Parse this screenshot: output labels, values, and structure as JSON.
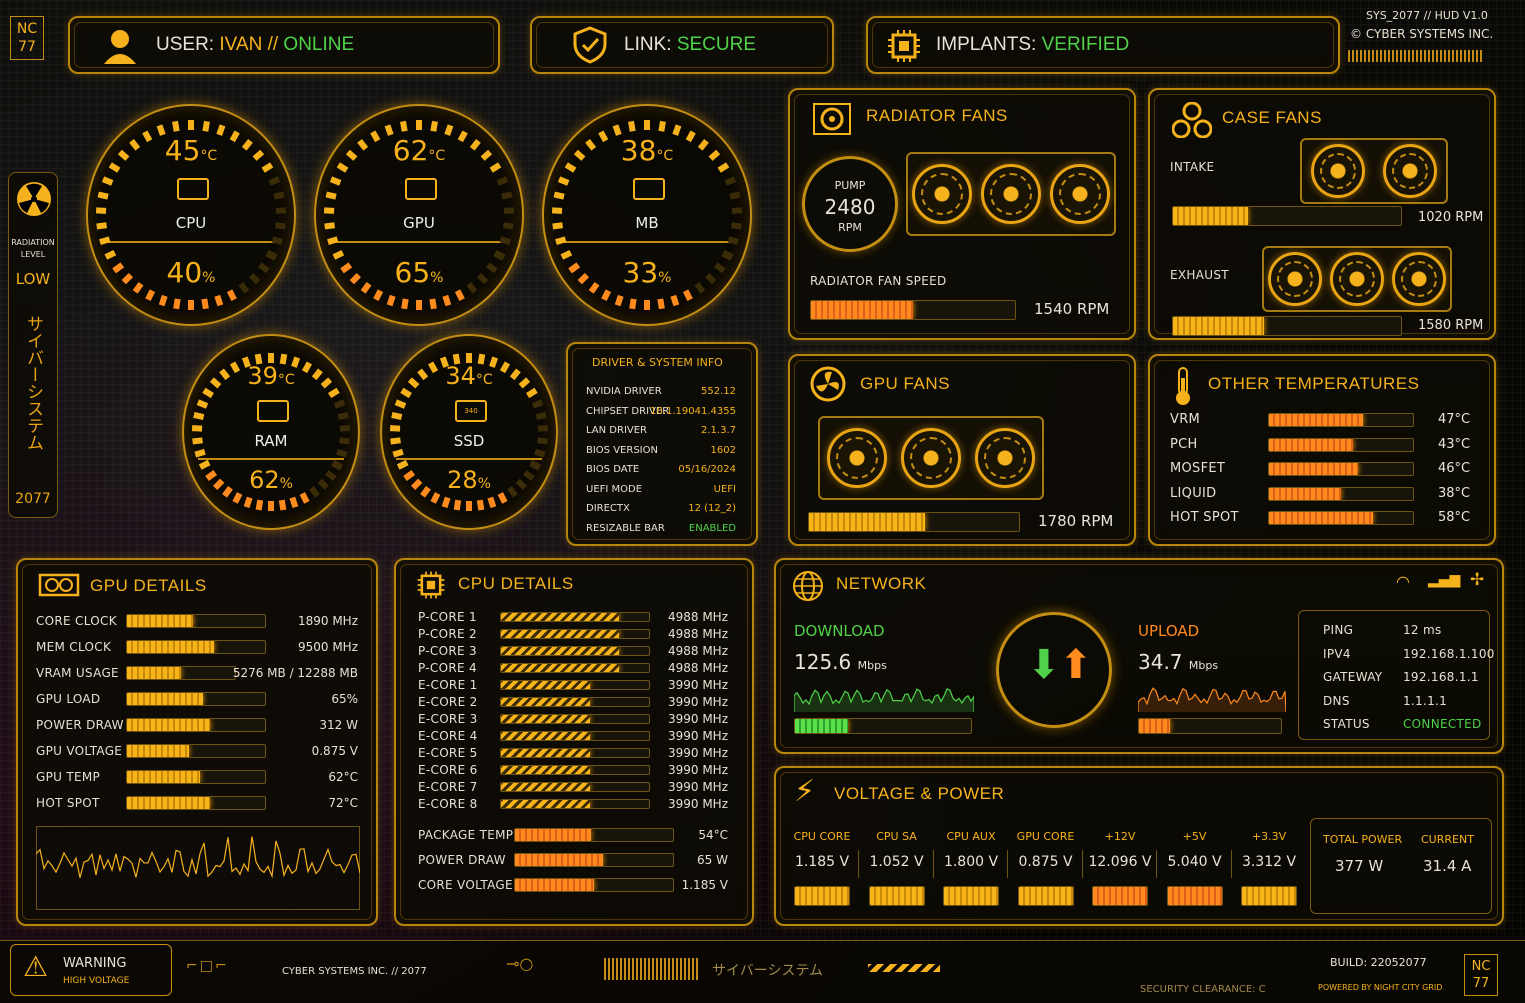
{
  "top": {
    "logo": "NC\n77",
    "user_label": "USER:",
    "user_name": "IVAN",
    "user_sep": "//",
    "user_status": "ONLINE",
    "link_label": "LINK:",
    "link_status": "SECURE",
    "implants_label": "IMPLANTS:",
    "implants_status": "VERIFIED",
    "sys": "SYS_2077 // HUD V1.0",
    "company": "© CYBER SYSTEMS INC."
  },
  "side": {
    "rad_label": "RADIATION LEVEL",
    "rad_value": "LOW",
    "jp": "サイバーシステム",
    "year": "2077"
  },
  "gauges": [
    {
      "name": "CPU",
      "temp": "45",
      "unit": "°C",
      "load": "40",
      "pct": "%"
    },
    {
      "name": "GPU",
      "temp": "62",
      "unit": "°C",
      "load": "65",
      "pct": "%"
    },
    {
      "name": "MB",
      "temp": "38",
      "unit": "°C",
      "load": "33",
      "pct": "%"
    },
    {
      "name": "RAM",
      "temp": "39",
      "unit": "°C",
      "load": "62",
      "pct": "%"
    },
    {
      "name": "SSD",
      "temp": "34",
      "unit": "°C",
      "load": "28",
      "pct": "%",
      "chip": "340"
    }
  ],
  "driver": {
    "title": "DRIVER & SYSTEM INFO",
    "rows": [
      {
        "k": "NVIDIA DRIVER",
        "v": "552.12"
      },
      {
        "k": "CHIPSET DRIVER",
        "v": "10.1.19041.4355"
      },
      {
        "k": "LAN DRIVER",
        "v": "2.1.3.7"
      },
      {
        "k": "BIOS VERSION",
        "v": "1602"
      },
      {
        "k": "BIOS DATE",
        "v": "05/16/2024"
      },
      {
        "k": "UEFI MODE",
        "v": "UEFI"
      },
      {
        "k": "DIRECTX",
        "v": "12 (12_2)"
      },
      {
        "k": "RESIZABLE BAR",
        "v": "ENABLED"
      }
    ]
  },
  "radiator": {
    "title": "RADIATOR FANS",
    "pump_label": "PUMP",
    "pump_value": "2480",
    "pump_unit": "RPM",
    "speed_label": "RADIATOR FAN SPEED",
    "speed": "1540 RPM",
    "fill": 0.5
  },
  "case": {
    "title": "CASE FANS",
    "intake_label": "INTAKE",
    "intake": "1020 RPM",
    "intake_fill": 0.33,
    "exhaust_label": "EXHAUST",
    "exhaust": "1580 RPM",
    "exhaust_fill": 0.4
  },
  "gpufans": {
    "title": "GPU FANS",
    "speed": "1780 RPM",
    "fill": 0.55
  },
  "othertemps": {
    "title": "OTHER TEMPERATURES",
    "rows": [
      {
        "k": "VRM",
        "v": "47°C",
        "f": 0.65
      },
      {
        "k": "PCH",
        "v": "43°C",
        "f": 0.58
      },
      {
        "k": "MOSFET",
        "v": "46°C",
        "f": 0.62
      },
      {
        "k": "LIQUID",
        "v": "38°C",
        "f": 0.5
      },
      {
        "k": "HOT SPOT",
        "v": "58°C",
        "f": 0.72
      }
    ]
  },
  "gpudetails": {
    "title": "GPU DETAILS",
    "rows": [
      {
        "k": "CORE CLOCK",
        "v": "1890 MHz",
        "f": 0.48
      },
      {
        "k": "MEM CLOCK",
        "v": "9500 MHz",
        "f": 0.63
      },
      {
        "k": "VRAM USAGE",
        "v": "5276 MB / 12288 MB",
        "f": 0.5
      },
      {
        "k": "GPU LOAD",
        "v": "65%",
        "f": 0.55
      },
      {
        "k": "POWER DRAW",
        "v": "312 W",
        "f": 0.6
      },
      {
        "k": "GPU VOLTAGE",
        "v": "0.875 V",
        "f": 0.45
      },
      {
        "k": "GPU TEMP",
        "v": "62°C",
        "f": 0.53
      },
      {
        "k": "HOT SPOT",
        "v": "72°C",
        "f": 0.6
      }
    ]
  },
  "cpudetails": {
    "title": "CPU DETAILS",
    "cores": [
      {
        "k": "P-CORE 1",
        "v": "4988 MHz",
        "f": 0.8
      },
      {
        "k": "P-CORE 2",
        "v": "4988 MHz",
        "f": 0.8
      },
      {
        "k": "P-CORE 3",
        "v": "4988 MHz",
        "f": 0.8
      },
      {
        "k": "P-CORE 4",
        "v": "4988 MHz",
        "f": 0.8
      },
      {
        "k": "E-CORE 1",
        "v": "3990 MHz",
        "f": 0.6
      },
      {
        "k": "E-CORE 2",
        "v": "3990 MHz",
        "f": 0.6
      },
      {
        "k": "E-CORE 3",
        "v": "3990 MHz",
        "f": 0.6
      },
      {
        "k": "E-CORE 4",
        "v": "3990 MHz",
        "f": 0.6
      },
      {
        "k": "E-CORE 5",
        "v": "3990 MHz",
        "f": 0.6
      },
      {
        "k": "E-CORE 6",
        "v": "3990 MHz",
        "f": 0.6
      },
      {
        "k": "E-CORE 7",
        "v": "3990 MHz",
        "f": 0.6
      },
      {
        "k": "E-CORE 8",
        "v": "3990 MHz",
        "f": 0.6
      }
    ],
    "extra": [
      {
        "k": "PACKAGE TEMP",
        "v": "54°C",
        "f": 0.48
      },
      {
        "k": "POWER DRAW",
        "v": "65 W",
        "f": 0.56
      },
      {
        "k": "CORE VOLTAGE",
        "v": "1.185 V",
        "f": 0.5
      }
    ]
  },
  "network": {
    "title": "NETWORK",
    "down_label": "DOWNLOAD",
    "down": "125.6",
    "down_unit": "Mbps",
    "up_label": "UPLOAD",
    "up": "34.7",
    "up_unit": "Mbps",
    "down_fill": 0.3,
    "up_fill": 0.22,
    "info": [
      {
        "k": "PING",
        "v": "12 ms"
      },
      {
        "k": "IPV4",
        "v": "192.168.1.100"
      },
      {
        "k": "GATEWAY",
        "v": "192.168.1.1"
      },
      {
        "k": "DNS",
        "v": "1.1.1.1"
      },
      {
        "k": "STATUS",
        "v": "CONNECTED"
      }
    ]
  },
  "voltage": {
    "title": "VOLTAGE & POWER",
    "cols": [
      {
        "k": "CPU CORE",
        "v": "1.185 V"
      },
      {
        "k": "CPU SA",
        "v": "1.052 V"
      },
      {
        "k": "CPU AUX",
        "v": "1.800 V"
      },
      {
        "k": "GPU CORE",
        "v": "0.875 V"
      },
      {
        "k": "+12V",
        "v": "12.096 V"
      },
      {
        "k": "+5V",
        "v": "5.040 V"
      },
      {
        "k": "+3.3V",
        "v": "3.312 V"
      }
    ],
    "total_label": "TOTAL POWER",
    "total": "377 W",
    "current_label": "CURRENT",
    "current": "31.4 A"
  },
  "footer": {
    "warn": "WARNING",
    "warn2": "HIGH VOLTAGE",
    "company": "CYBER SYSTEMS INC. // 2077",
    "jp": "サイバーシステム",
    "clearance": "SECURITY CLEARANCE: C",
    "build": "BUILD: 22052077",
    "powered": "POWERED BY NIGHT CITY GRID",
    "logo": "NC\n77"
  },
  "colors": {
    "accent": "#f7b21b",
    "green": "#4fd24a",
    "orange": "#ff8a1e"
  }
}
